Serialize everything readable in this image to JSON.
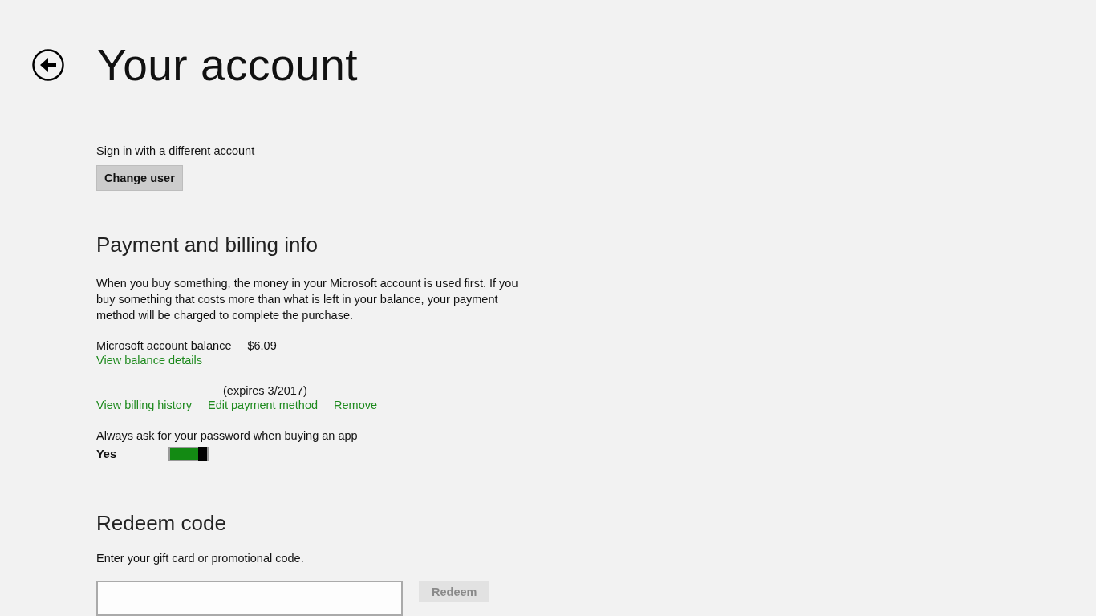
{
  "page": {
    "title": "Your account"
  },
  "account": {
    "prompt": "Sign in with a different account",
    "button": "Change user"
  },
  "billing": {
    "heading": "Payment and billing info",
    "description": "When you buy something, the money in your Microsoft account is used first. If you buy something that costs more than what is left in your balance, your payment method will be charged to complete the purchase.",
    "balance_label": "Microsoft account balance",
    "balance_value": "$6.09",
    "balance_link": "View balance details",
    "payment_method": "(expires 3/2017)",
    "links": [
      "View billing history",
      "Edit payment method",
      "Remove"
    ],
    "password_label": "Always ask for your password when buying an app",
    "password_value": "Yes",
    "password_on": true
  },
  "redeem": {
    "heading": "Redeem code",
    "prompt": "Enter your gift card or promotional code.",
    "button": "Redeem",
    "button_disabled": true
  }
}
